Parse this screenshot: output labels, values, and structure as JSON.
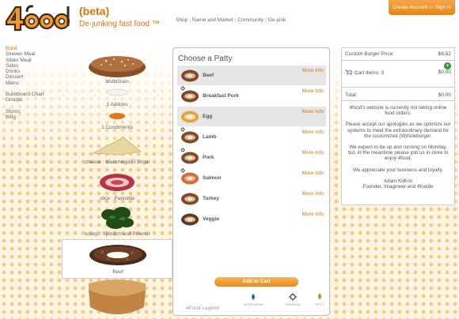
{
  "header": {
    "logo_text": "4food",
    "beta": "(beta)",
    "tagline_prefix": "De",
    "tagline_rest": "·junking fast food ™",
    "nav": [
      "Shop",
      "Name and Market",
      "Community",
      "De-junk"
    ],
    "create_account": "Create Account",
    "or": "or",
    "sign_in": "Sign in"
  },
  "sidebar": {
    "group1": [
      "Build",
      "Skewer Meal",
      "Slider Meal",
      "Sides",
      "Drinks",
      "Dessert",
      "Menu"
    ],
    "group2": [
      "Buildboard Chart",
      "Groups"
    ],
    "group3": [
      "Stores",
      "Blog"
    ]
  },
  "stack": {
    "bun_label": "MultiGrain",
    "addons_label": "1 Addons",
    "condiments_label": "1 Condiments",
    "cheese_label": "cheese : Manchego El Trigal",
    "slice_label": "slice : Pancetta",
    "scoop_label": "scoop : Spinach and Pinenut",
    "patty_label": "Beef"
  },
  "patty_panel": {
    "title": "Choose a Patty",
    "more_info": "More Info",
    "items": [
      {
        "name": "Beef",
        "highlight": true,
        "veg": false,
        "premium": false
      },
      {
        "name": "Breakfast Pork",
        "highlight": false,
        "veg": false,
        "premium": true
      },
      {
        "name": "Egg",
        "highlight": true,
        "veg": false,
        "premium": false
      },
      {
        "name": "Lamb",
        "highlight": false,
        "veg": false,
        "premium": true
      },
      {
        "name": "Pork",
        "highlight": false,
        "veg": false,
        "premium": true
      },
      {
        "name": "Salmon",
        "highlight": false,
        "veg": false,
        "premium": true
      },
      {
        "name": "Turkey",
        "highlight": false,
        "veg": false,
        "premium": false
      },
      {
        "name": "Veggie",
        "highlight": false,
        "veg": false,
        "premium": false
      }
    ],
    "add_to_cart": "Add to Cart",
    "legend_title": "4Food Legend",
    "legend": [
      "VEGETARIAN",
      "PREMIUM",
      "SPICY"
    ]
  },
  "cart": {
    "custom_price_label": "Custom Burger Price:",
    "custom_price": "$6.52",
    "cart_items_label": "Cart Items: 0",
    "cart_items_value": "$0.00",
    "total_label": "Total:",
    "total_value": "$0.00",
    "notice": [
      "4food's website is currently not taking online food orders.",
      "Please accept our apologies as we optimize our systems to meet the extraordinary demand for the customized (W)holeburger.",
      "We expect to be up and running on Monday, but, in the meantime please join us in-store to enjoy 4food.",
      "We appreciate your business and loyalty.",
      "Adam Kidron\nFounder, Imagineer and 4foodie"
    ]
  },
  "colors": {
    "accent": "#e0730a",
    "dots": "#f1c989",
    "add_button": "#ea8a17",
    "plus": "#2f9a2f"
  }
}
